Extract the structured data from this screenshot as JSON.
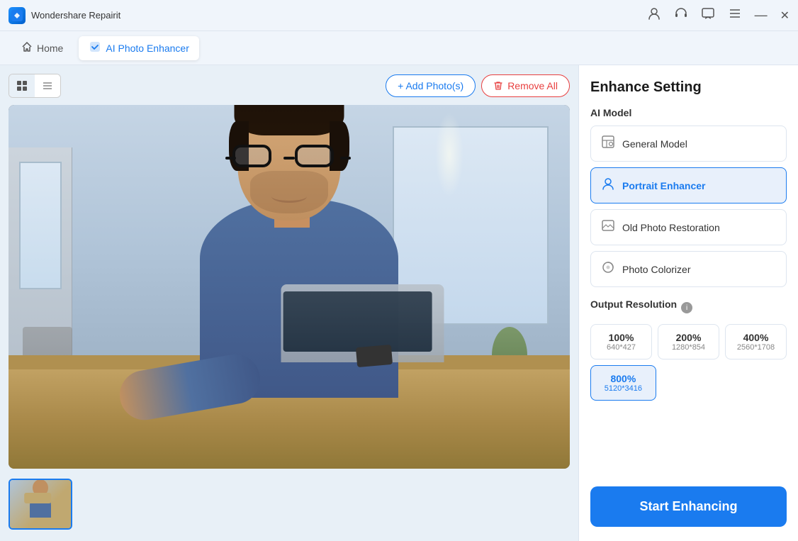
{
  "app": {
    "name": "Wondershare Repairit",
    "icon": "W"
  },
  "titlebar": {
    "title": "Wondershare Repairit",
    "icons": {
      "account": "👤",
      "headset": "🎧",
      "chat": "💬",
      "menu": "☰",
      "minimize": "—",
      "close": "✕"
    }
  },
  "navbar": {
    "home_label": "Home",
    "active_tab_label": "AI Photo Enhancer"
  },
  "toolbar": {
    "add_label": "+ Add Photo(s)",
    "remove_label": "Remove All"
  },
  "right_panel": {
    "title": "Enhance Setting",
    "ai_model_label": "AI Model",
    "models": [
      {
        "id": "general",
        "label": "General Model",
        "icon": "🖼",
        "selected": false
      },
      {
        "id": "portrait",
        "label": "Portrait Enhancer",
        "icon": "👤",
        "selected": true
      },
      {
        "id": "old-photo",
        "label": "Old Photo Restoration",
        "icon": "🖼",
        "selected": false
      },
      {
        "id": "colorizer",
        "label": "Photo Colorizer",
        "icon": "🎨",
        "selected": false
      }
    ],
    "output_resolution_label": "Output Resolution",
    "resolutions": [
      {
        "id": "100",
        "pct": "100%",
        "dim": "640*427",
        "selected": false
      },
      {
        "id": "200",
        "pct": "200%",
        "dim": "1280*854",
        "selected": false
      },
      {
        "id": "400",
        "pct": "400%",
        "dim": "2560*1708",
        "selected": false
      },
      {
        "id": "800",
        "pct": "800%",
        "dim": "5120*3416",
        "selected": true
      }
    ],
    "start_label": "Start Enhancing"
  }
}
